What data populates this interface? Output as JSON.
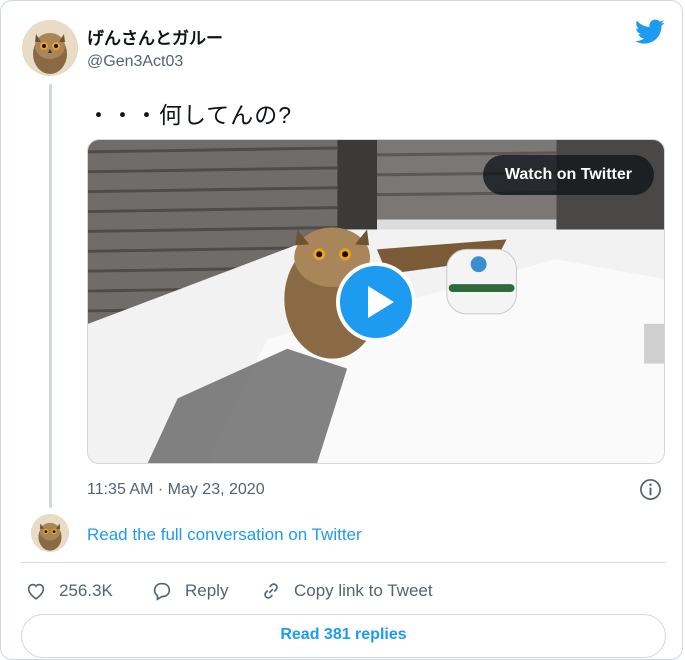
{
  "author": {
    "name": "げんさんとガルー",
    "handle": "@Gen3Act03",
    "avatar_icon": "owl-avatar"
  },
  "brand_icon": "twitter-bird-icon",
  "brand_color": "#1d9bf0",
  "tweet": {
    "text": "・・・何してんの?",
    "timestamp": "11:35 AM · May 23, 2020"
  },
  "media": {
    "watch_label": "Watch on Twitter",
    "play_icon": "play-icon"
  },
  "conversation_link": "Read the full conversation on Twitter",
  "actions": {
    "like_count": "256.3K",
    "reply_label": "Reply",
    "copy_label": "Copy link to Tweet"
  },
  "replies_button": "Read 381 replies"
}
